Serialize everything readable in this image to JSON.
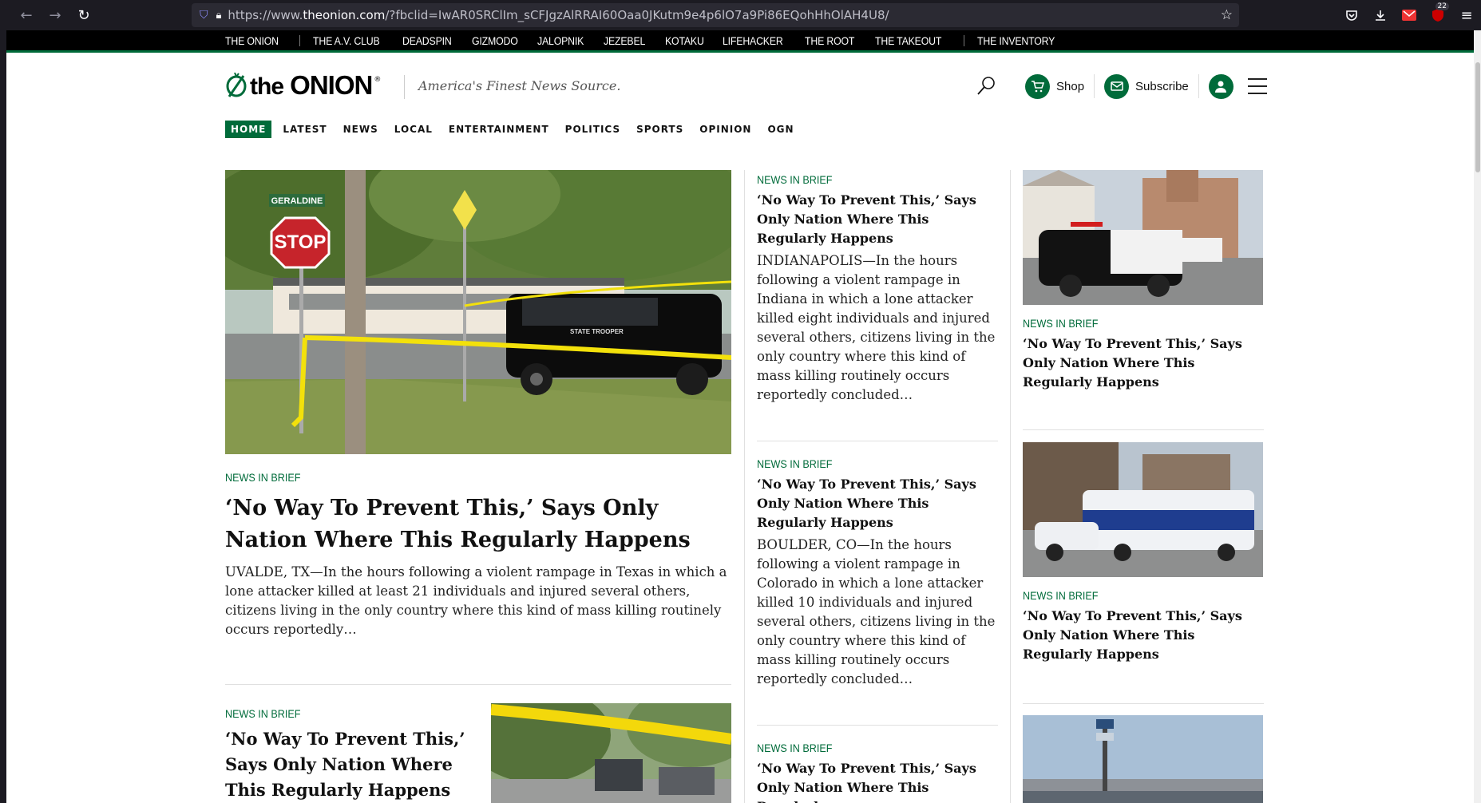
{
  "browser": {
    "url_prefix": "https://www.",
    "url_domain": "theonion.com",
    "url_rest": "/?fbclid=IwAR0SRClIm_sCFJgzAlRRAI60Oaa0JKutm9e4p6lO7a9Pi86EQohHhOlAH4U8/",
    "extensions_badge": "22"
  },
  "network": {
    "links": [
      "THE ONION",
      "THE A.V. CLUB",
      "DEADSPIN",
      "GIZMODO",
      "JALOPNIK",
      "JEZEBEL",
      "KOTAKU",
      "LIFEHACKER",
      "THE ROOT",
      "THE TAKEOUT",
      "THE INVENTORY"
    ]
  },
  "site": {
    "logo_the": "the",
    "logo_onion": "ONION",
    "tagline": "America's Finest News Source.",
    "shop_label": "Shop",
    "subscribe_label": "Subscribe",
    "accent_color": "#006b3a"
  },
  "sections": [
    "HOME",
    "LATEST",
    "NEWS",
    "LOCAL",
    "ENTERTAINMENT",
    "POLITICS",
    "SPORTS",
    "OPINION",
    "OGN"
  ],
  "main_story": {
    "kicker": "NEWS IN BRIEF",
    "headline": "‘No Way To Prevent This,’ Says Only Nation Where This Regularly Happens",
    "excerpt": "UVALDE, TX—In the hours following a violent rampage in Texas in which a lone attacker killed at least 21 individuals and injured several others, citizens living in the only country where this kind of mass killing routinely occurs reportedly…"
  },
  "second_story": {
    "kicker": "NEWS IN BRIEF",
    "headline": "‘No Way To Prevent This,’ Says Only Nation Where This Regularly Happens"
  },
  "mid_column": [
    {
      "kicker": "NEWS IN BRIEF",
      "headline": "‘No Way To Prevent This,’ Says Only Nation Where This Regularly Happens",
      "excerpt": "INDIANAPOLIS—In the hours following a violent rampage in Indiana in which a lone attacker killed eight individuals and injured several others, citizens living in the only country where this kind of mass killing routinely occurs reportedly concluded…"
    },
    {
      "kicker": "NEWS IN BRIEF",
      "headline": "‘No Way To Prevent This,’ Says Only Nation Where This Regularly Happens",
      "excerpt": "BOULDER, CO—In the hours following a violent rampage in Colorado in which a lone attacker killed 10 individuals and injured several others, citizens living in the only country where this kind of mass killing routinely occurs reportedly concluded…"
    },
    {
      "kicker": "NEWS IN BRIEF",
      "headline": "‘No Way To Prevent This,’ Says Only Nation Where This Regularly"
    }
  ],
  "right_column": [
    {
      "kicker": "NEWS IN BRIEF",
      "headline": "‘No Way To Prevent This,’ Says Only Nation Where This Regularly Happens"
    },
    {
      "kicker": "NEWS IN BRIEF",
      "headline": "‘No Way To Prevent This,’ Says Only Nation Where This Regularly Happens"
    }
  ],
  "photo_text": {
    "stop_sign": "STOP",
    "street_sign": "GERALDINE",
    "vehicle_marking": "STATE TROOPER"
  }
}
